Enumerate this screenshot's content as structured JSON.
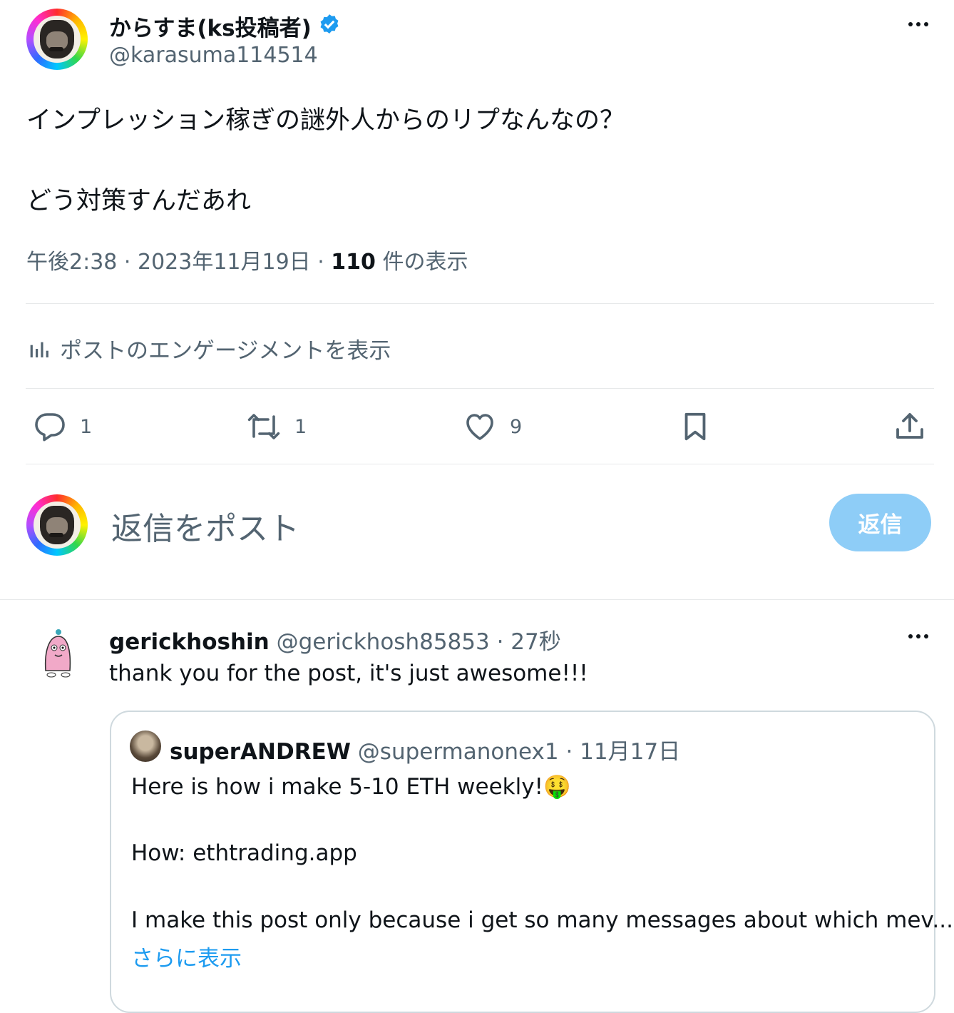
{
  "tweet": {
    "author_name": "からすま(ks投稿者)",
    "author_handle": "@karasuma114514",
    "avatar_icon": "rainbow-frame-avatar",
    "verified_icon": "verified-badge-icon",
    "verified_color": "#1d9bf0",
    "text_line1": "インプレッション稼ぎの謎外人からのリプなんなの？",
    "text_line2": "どう対策すんだあれ",
    "time": "午後2:38 · 2023年11月19日 · ",
    "views_count": "110",
    "views_label": " 件の表示",
    "engagement_label": "ポストのエンゲージメントを表示",
    "actions": {
      "reply_count": "1",
      "retweet_count": "1",
      "like_count": "9"
    }
  },
  "composer": {
    "placeholder": "返信をポスト",
    "button_label": "返信",
    "button_color": "#8ecdf7"
  },
  "reply": {
    "author_name": "gerickhoshin",
    "author_handle": "@gerickhosh85853",
    "time": "27秒",
    "separator": " · ",
    "text": "thank you for the post, it's just awesome!!!",
    "quote": {
      "author_name": "superANDREW",
      "author_handle": "@supermanonex1",
      "time": "11月17日",
      "line1": "Here is how i make 5-10 ETH weekly!",
      "emoji": "🤑",
      "line2": "How: ethtrading.app",
      "line3": "I make this post only because i get so many messages about which mev...",
      "show_more": "さらに表示",
      "link_color": "#1d9bf0"
    }
  }
}
